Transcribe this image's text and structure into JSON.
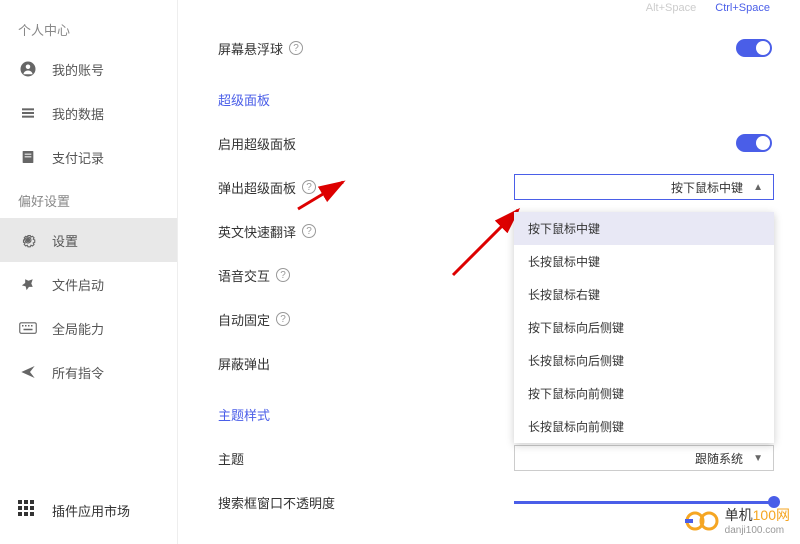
{
  "shortcuts": {
    "alt": "Alt+Space",
    "ctrl": "Ctrl+Space"
  },
  "sidebar": {
    "personal_center": "个人中心",
    "preferences": "偏好设置",
    "items": [
      {
        "label": "我的账号"
      },
      {
        "label": "我的数据"
      },
      {
        "label": "支付记录"
      },
      {
        "label": "设置"
      },
      {
        "label": "文件启动"
      },
      {
        "label": "全局能力"
      },
      {
        "label": "所有指令"
      }
    ],
    "plugin_market": "插件应用市场"
  },
  "settings": {
    "floating_ball": "屏幕悬浮球",
    "super_panel_section": "超级面板",
    "enable_super_panel": "启用超级面板",
    "popup_super_panel": "弹出超级面板",
    "quick_translate": "英文快速翻译",
    "voice_interact": "语音交互",
    "auto_fixed": "自动固定",
    "screen_popup": "屏蔽弹出",
    "theme_section": "主题样式",
    "theme": "主题",
    "search_opacity": "搜索框窗口不透明度"
  },
  "dropdown": {
    "selected": "按下鼠标中键",
    "options": [
      "按下鼠标中键",
      "长按鼠标中键",
      "长按鼠标右键",
      "按下鼠标向后侧键",
      "长按鼠标向后侧键",
      "按下鼠标向前侧键",
      "长按鼠标向前侧键"
    ]
  },
  "theme_dropdown": {
    "selected": "跟随系统"
  },
  "watermark": {
    "brand_prefix": "单机",
    "brand_suffix": "100网",
    "url": "danji100.com"
  }
}
